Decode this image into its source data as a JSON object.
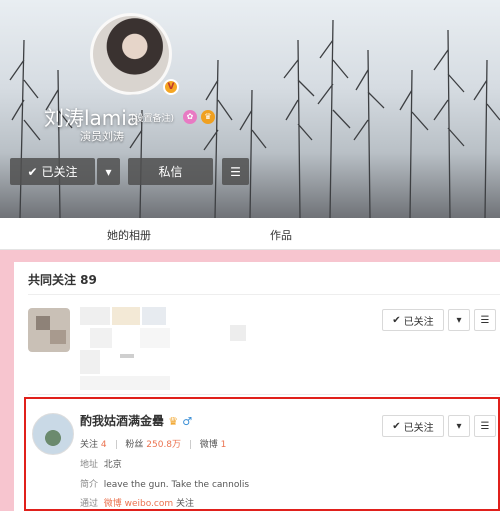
{
  "profile": {
    "name": "刘涛lamia",
    "remark": "(设置备注)",
    "subtitle": "演员刘涛",
    "verified_badge": "V",
    "follow_button": "已关注",
    "message_button": "私信",
    "icons": [
      "check-icon",
      "chevron-down-icon",
      "menu-icon"
    ]
  },
  "tabs": {
    "album": "她的相册",
    "works": "作品"
  },
  "mutual": {
    "title": "共同关注 89"
  },
  "users": [
    {
      "follow_label": "已关注"
    },
    {
      "name": "酌我姑酒满金罍",
      "gender_icon": "♂",
      "following_label": "关注",
      "following_count": "4",
      "fans_label": "粉丝",
      "fans_count": "250.8万",
      "weibo_label": "微博",
      "weibo_count": "1",
      "location_label": "地址",
      "location": "北京",
      "bio_label": "简介",
      "bio": "leave the gun. Take the cannolis",
      "via_label": "通过",
      "via_source": "微博 weibo.com",
      "via_suffix": "关注",
      "follow_label": "已关注"
    }
  ],
  "colors": {
    "background": "#f7c5cf",
    "highlight": "#e0201b",
    "accent": "#eb7350"
  }
}
